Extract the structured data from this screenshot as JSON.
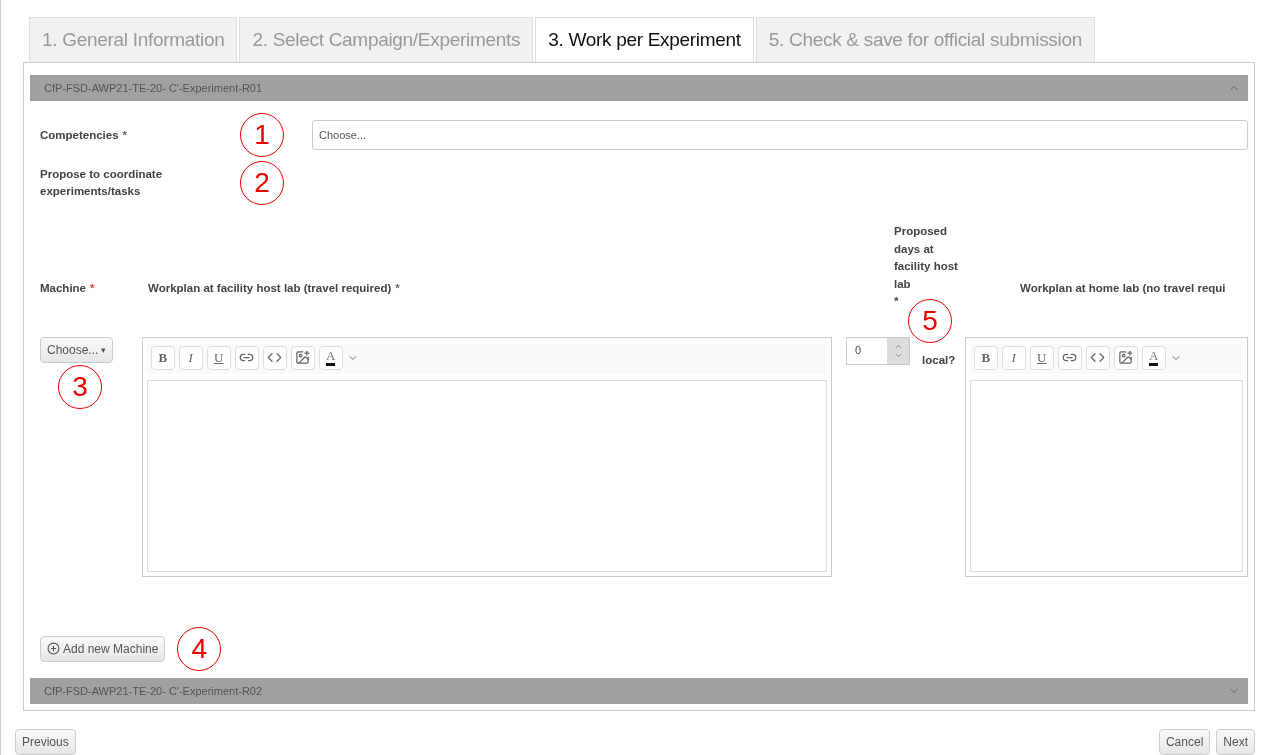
{
  "tabs": [
    {
      "label": "1. General Information",
      "selected": false
    },
    {
      "label": "2. Select Campaign/Experiments",
      "selected": false
    },
    {
      "label": "3. Work per Experiment",
      "selected": true
    },
    {
      "label": "5. Check & save for official submission",
      "selected": false
    }
  ],
  "sections": [
    {
      "title": "CfP-FSD-AWP21-TE-20- C'-Experiment-R01",
      "expanded": true
    },
    {
      "title": "CfP-FSD-AWP21-TE-20- C'-Experiment-R02",
      "expanded": false
    }
  ],
  "competencies": {
    "label": "Competencies",
    "marker": "*",
    "callout": "1",
    "placeholder": "Choose..."
  },
  "coordinate": {
    "label": "Propose to coordinate experiments/tasks",
    "callout": "2"
  },
  "machine": {
    "label": "Machine",
    "marker": "*",
    "select": "Choose...",
    "caret": "▾",
    "callout": "3"
  },
  "host_workplan": {
    "label": "Workplan at facility host lab (travel required)",
    "marker": "*",
    "toolbar": [
      "B",
      "I",
      "U",
      "A"
    ]
  },
  "days": {
    "label": "Proposed days at facility host lab",
    "marker": "*",
    "value": "0",
    "callout": "5",
    "local_label": "local?"
  },
  "home_workplan": {
    "label": "Workplan at home lab (no travel requi",
    "toolbar": [
      "B",
      "I",
      "U",
      "A"
    ]
  },
  "add_machine": {
    "label": "Add new Machine",
    "callout": "4"
  },
  "footer": {
    "previous": "Previous",
    "cancel": "Cancel",
    "next": "Next"
  }
}
